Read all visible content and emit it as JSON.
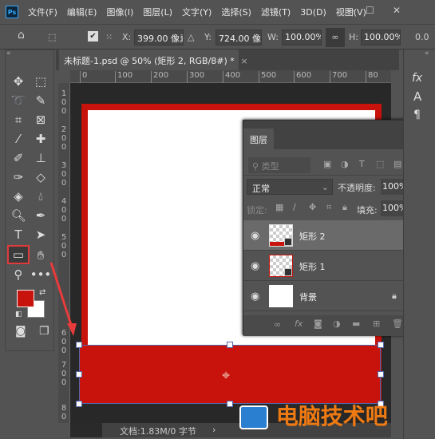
{
  "app": {
    "logo": "Ps"
  },
  "menu": [
    "文件(F)",
    "编辑(E)",
    "图像(I)",
    "图层(L)",
    "文字(Y)",
    "选择(S)",
    "滤镜(T)",
    "3D(D)",
    "视图(V)"
  ],
  "window_controls": {
    "minimize": "—",
    "maximize": "☐",
    "close": "✕"
  },
  "options": {
    "x_label": "X:",
    "x_value": "399.00 像素",
    "y_label": "Y:",
    "y_value": "724.00 像素",
    "w_label": "W:",
    "w_value": "100.00%",
    "h_label": "H:",
    "h_value": "100.00%",
    "angle_value": "0.0"
  },
  "document_tab": {
    "title": "未标题-1.psd @ 50% (矩形 2, RGB/8#) *",
    "close": "×"
  },
  "ruler_top": [
    "0",
    "100",
    "200",
    "300",
    "400",
    "500",
    "600",
    "700",
    "80"
  ],
  "ruler_left": [
    "1",
    "2",
    "3",
    "4",
    "5",
    "6",
    "7",
    "8"
  ],
  "colors": {
    "foreground": "#c8120c",
    "background": "#ffffff",
    "accent_red": "#c8120c",
    "selection": "#5566aa"
  },
  "layers_panel": {
    "title": "图层",
    "filter_placeholder": "类型",
    "blend_mode": "正常",
    "opacity_label": "不透明度:",
    "opacity_value": "100%",
    "lock_label": "锁定:",
    "fill_label": "填充:",
    "fill_value": "100%",
    "layers": [
      {
        "name": "矩形 2",
        "selected": true,
        "visible": true
      },
      {
        "name": "矩形 1",
        "selected": false,
        "visible": true
      },
      {
        "name": "背景",
        "selected": false,
        "visible": true,
        "locked": true
      }
    ]
  },
  "status": {
    "doc_info": "文档:1.83M/0 字节"
  },
  "watermark": "电脑技术吧"
}
